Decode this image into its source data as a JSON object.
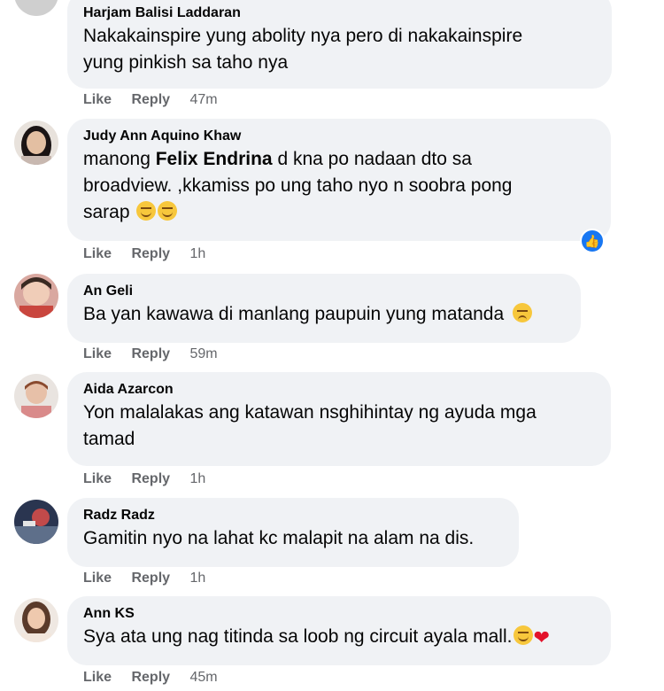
{
  "comments": [
    {
      "author": "Harjam Balisi Laddaran",
      "text_line1": "Nakakainspire yung abolity nya pero di nakakainspire",
      "text_line2": "yung pinkish sa taho nya",
      "like": "Like",
      "reply": "Reply",
      "time": "47m"
    },
    {
      "author": "Judy Ann Aquino Khaw",
      "text_pre": "manong ",
      "mention": "Felix Endrina",
      "text_post": " d kna po nadaan dto sa",
      "text_line2": "broadview. ,kkamiss po ung taho nyo n soobra pong",
      "text_line3": "sarap",
      "emoji": "smiling-face-icon",
      "reaction_icon": "thumbs-up-icon",
      "like": "Like",
      "reply": "Reply",
      "time": "1h"
    },
    {
      "author": "An Geli",
      "text": "Ba yan kawawa di manlang paupuin yung matanda",
      "emoji": "sad-face-icon",
      "like": "Like",
      "reply": "Reply",
      "time": "59m"
    },
    {
      "author": "Aida Azarcon",
      "text_line1": "Yon malalakas ang katawan nsghihintay ng ayuda mga",
      "text_line2": "tamad",
      "like": "Like",
      "reply": "Reply",
      "time": "1h"
    },
    {
      "author": "Radz Radz",
      "text": "Gamitin nyo na lahat kc malapit na alam na dis.",
      "like": "Like",
      "reply": "Reply",
      "time": "1h"
    },
    {
      "author": "Ann KS",
      "text": "Sya ata ung nag titinda sa loob ng circuit ayala mall.",
      "emoji": "smiling-face-icon",
      "emoji2": "red-heart-icon",
      "like": "Like",
      "reply": "Reply",
      "time": "45m"
    }
  ],
  "colors": {
    "bubble": "#f0f2f5",
    "action_text": "#65676b",
    "like_badge": "#1877f2"
  }
}
